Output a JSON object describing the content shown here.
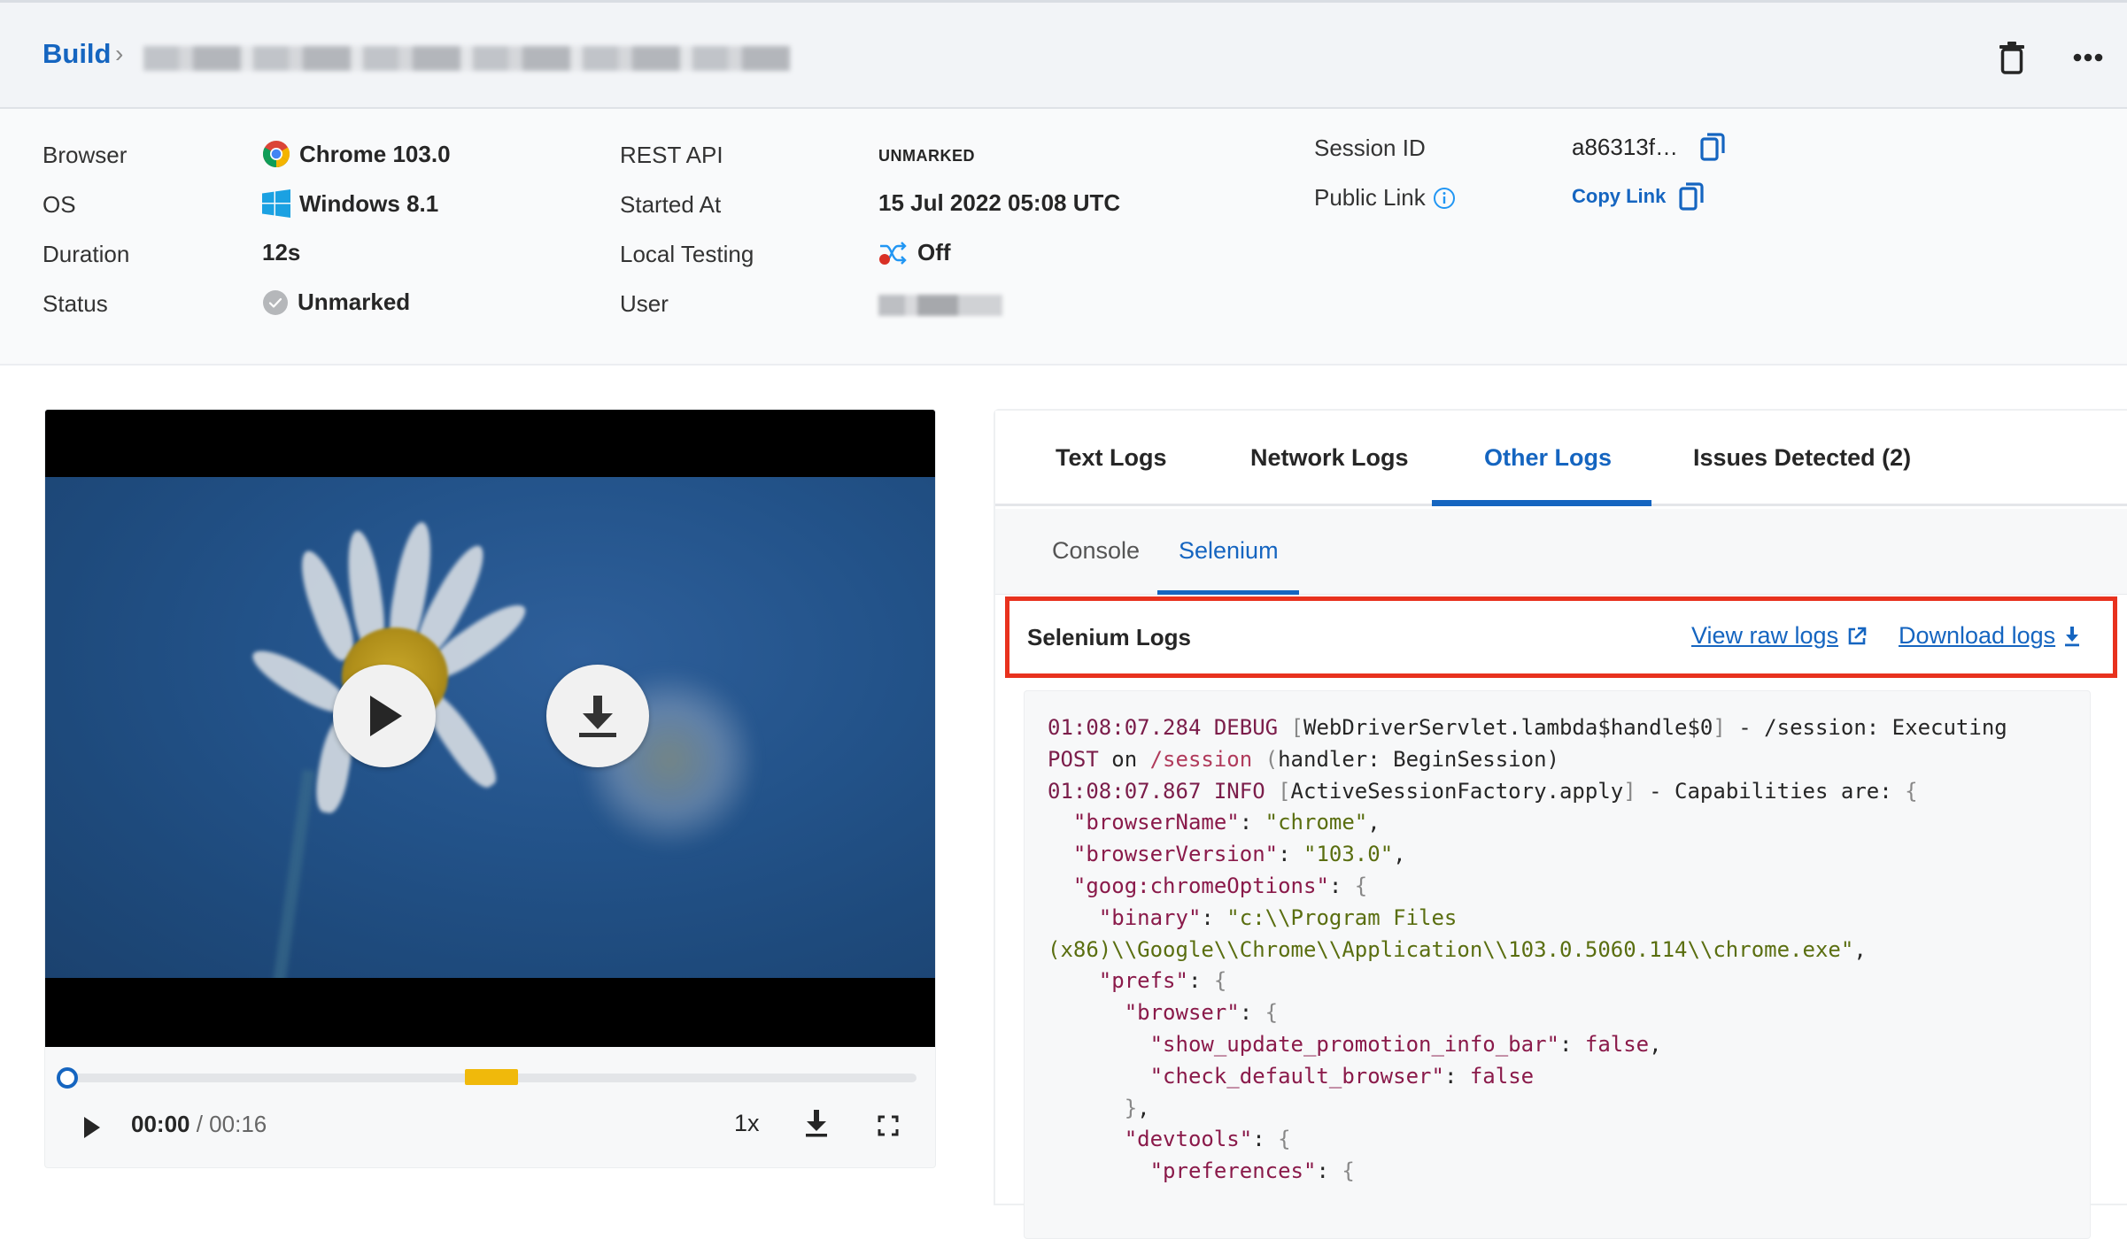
{
  "header": {
    "breadcrumb_root": "Build",
    "breadcrumb_separator": "›",
    "build_title_redacted": true,
    "actions": [
      "delete-icon",
      "more-options-icon"
    ]
  },
  "info": {
    "browser": {
      "label": "Browser",
      "value": "Chrome 103.0",
      "icon": "chrome-icon"
    },
    "os": {
      "label": "OS",
      "value": "Windows 8.1",
      "icon": "windows-icon"
    },
    "duration": {
      "label": "Duration",
      "value": "12s"
    },
    "status": {
      "label": "Status",
      "value": "Unmarked",
      "icon": "check-circle-icon"
    },
    "rest_api": {
      "label": "REST API",
      "value": "UNMARKED"
    },
    "started_at": {
      "label": "Started At",
      "value": "15 Jul 2022 05:08 UTC"
    },
    "local_testing": {
      "label": "Local Testing",
      "value": "Off",
      "icon": "local-testing-icon"
    },
    "user": {
      "label": "User",
      "value_redacted": true
    },
    "session_id": {
      "label": "Session ID",
      "value": "a86313f…",
      "icon": "copy-icon"
    },
    "public_link": {
      "label": "Public Link",
      "value": "Copy Link",
      "icon": "copy-icon",
      "info_icon": "info-icon"
    }
  },
  "video": {
    "current_time": "00:00",
    "time_separator": " / ",
    "total_time": "00:16",
    "speed": "1x",
    "progress_fraction": 0.0,
    "marker_position_fraction": 0.5,
    "marker_color": "#f0b90b",
    "overlay_buttons": [
      "play-icon",
      "download-icon"
    ],
    "controls": [
      "play-icon",
      "speed",
      "download-icon",
      "fullscreen-icon"
    ]
  },
  "logs": {
    "tabs": [
      {
        "label": "Text Logs",
        "active": false
      },
      {
        "label": "Network Logs",
        "active": false
      },
      {
        "label": "Other Logs",
        "active": true
      },
      {
        "label": "Issues Detected (2)",
        "active": false
      }
    ],
    "subtabs": [
      {
        "label": "Console",
        "active": false
      },
      {
        "label": "Selenium",
        "active": true
      }
    ],
    "section_title": "Selenium Logs",
    "view_raw_label": "View raw logs",
    "download_label": "Download logs",
    "lines": [
      "01:08:07.284 DEBUG [WebDriverServlet.lambda$handle$0] - /session: Executing",
      "POST on /session (handler: BeginSession)",
      "01:08:07.867 INFO [ActiveSessionFactory.apply] - Capabilities are: {",
      "  \"browserName\": \"chrome\",",
      "  \"browserVersion\": \"103.0\",",
      "  \"goog:chromeOptions\": {",
      "    \"binary\": \"c:\\\\Program Files",
      "(x86)\\\\Google\\\\Chrome\\\\Application\\\\103.0.5060.114\\\\chrome.exe\",",
      "    \"prefs\": {",
      "      \"browser\": {",
      "        \"show_update_promotion_info_bar\": false,",
      "        \"check_default_browser\": false",
      "      },",
      "      \"devtools\": {",
      "        \"preferences\": {"
    ]
  },
  "colors": {
    "accent": "#1565c0",
    "highlight_border": "#e8321e",
    "header_bg": "#f2f4f7",
    "info_bg": "#f9fafb"
  }
}
